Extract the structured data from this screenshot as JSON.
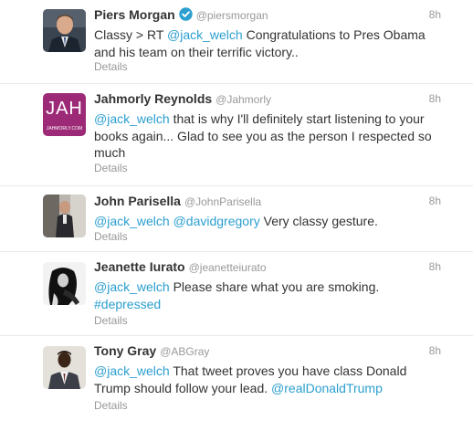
{
  "tweets": [
    {
      "name": "Piers Morgan",
      "handle": "@piersmorgan",
      "time": "8h",
      "verified": true,
      "details": "Details",
      "avatar_icon": "person-avatar-suit",
      "body": [
        [
          {
            "t": "text",
            "v": "Classy > RT "
          },
          {
            "t": "mention",
            "v": "@jack_welch"
          },
          {
            "t": "text",
            "v": " Congratulations to Pres Obama"
          }
        ],
        [
          {
            "t": "text",
            "v": "and his team on their terrific victory.."
          }
        ]
      ]
    },
    {
      "name": "Jahmorly Reynolds",
      "handle": "@Jahmorly",
      "time": "8h",
      "verified": false,
      "details": "Details",
      "avatar_icon": "jah-logo-avatar",
      "avatar_text": "JAH",
      "avatar_subtext": "JAHMORLY.COM",
      "body": [
        [
          {
            "t": "mention",
            "v": "@jack_welch"
          },
          {
            "t": "text",
            "v": " that is why I'll definitely start listening to your"
          }
        ],
        [
          {
            "t": "text",
            "v": "books again... Glad to see you as the person I respected so"
          }
        ],
        [
          {
            "t": "text",
            "v": "much"
          }
        ]
      ]
    },
    {
      "name": "John Parisella",
      "handle": "@JohnParisella",
      "time": "8h",
      "verified": false,
      "details": "Details",
      "avatar_icon": "person-avatar-photo",
      "body": [
        [
          {
            "t": "mention",
            "v": "@jack_welch"
          },
          {
            "t": "text",
            "v": " "
          },
          {
            "t": "mention",
            "v": "@davidgregory"
          },
          {
            "t": "text",
            "v": " Very classy gesture."
          }
        ]
      ]
    },
    {
      "name": "Jeanette Iurato",
      "handle": "@jeanetteiurato",
      "time": "8h",
      "verified": false,
      "details": "Details",
      "avatar_icon": "person-avatar-bw",
      "body": [
        [
          {
            "t": "mention",
            "v": "@jack_welch"
          },
          {
            "t": "text",
            "v": " Please share what you are smoking."
          }
        ],
        [
          {
            "t": "hashtag",
            "v": "#depressed"
          }
        ]
      ]
    },
    {
      "name": "Tony Gray",
      "handle": "@ABGray",
      "time": "8h",
      "verified": false,
      "details": "Details",
      "avatar_icon": "person-avatar-portrait",
      "body": [
        [
          {
            "t": "mention",
            "v": "@jack_welch"
          },
          {
            "t": "text",
            "v": " That tweet proves you have class Donald"
          }
        ],
        [
          {
            "t": "text",
            "v": "Trump should follow your lead. "
          },
          {
            "t": "mention",
            "v": "@realDonaldTrump"
          }
        ]
      ]
    }
  ],
  "colors": {
    "link": "#2b9fcf",
    "verified": "#2b9fcf",
    "muted": "#999999",
    "jah_avatar_bg": "#9c2a76"
  }
}
